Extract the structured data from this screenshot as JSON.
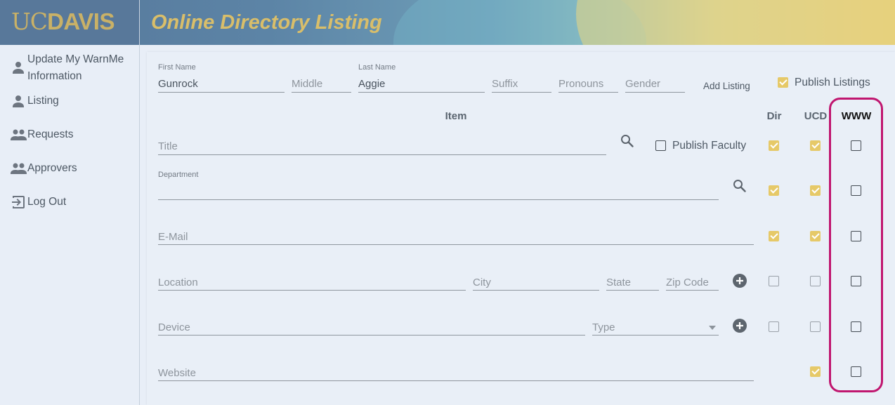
{
  "header": {
    "logo_uc": "UC",
    "logo_davis": "DAVIS",
    "title": "Online Directory Listing"
  },
  "sidebar": {
    "items": [
      {
        "label_line1": "Update My WarnMe",
        "label_line2": "Information",
        "icon": "person-icon"
      },
      {
        "label": "Listing",
        "icon": "person-icon"
      },
      {
        "label": "Requests",
        "icon": "people-icon"
      },
      {
        "label": "Approvers",
        "icon": "people-icon"
      },
      {
        "label": "Log Out",
        "icon": "logout-icon"
      }
    ]
  },
  "name_row": {
    "first_name": {
      "label": "First Name",
      "value": "Gunrock"
    },
    "middle": {
      "placeholder": "Middle"
    },
    "last_name": {
      "label": "Last Name",
      "value": "Aggie"
    },
    "suffix": {
      "placeholder": "Suffix"
    },
    "pronouns": {
      "placeholder": "Pronouns"
    },
    "gender": {
      "placeholder": "Gender"
    },
    "add_listing_label": "Add Listing",
    "publish_listings": {
      "label": "Publish Listings",
      "checked": true
    }
  },
  "columns": {
    "item": "Item",
    "dir": "Dir",
    "ucd": "UCD",
    "www": "WWW"
  },
  "rows": {
    "title": {
      "placeholder": "Title",
      "publish_faculty_label": "Publish Faculty",
      "publish_faculty_checked": false,
      "dir": true,
      "ucd": true,
      "www": false
    },
    "department": {
      "label": "Department",
      "value": "",
      "dir": true,
      "ucd": true,
      "www": false
    },
    "email": {
      "placeholder": "E-Mail",
      "dir": true,
      "ucd": true,
      "www": false
    },
    "location": {
      "placeholder": "Location",
      "city_placeholder": "City",
      "state_placeholder": "State",
      "zip_placeholder": "Zip Code",
      "dir": false,
      "ucd": false,
      "www": false
    },
    "device": {
      "placeholder": "Device",
      "type_placeholder": "Type",
      "dir": false,
      "ucd": false,
      "www": false
    },
    "website": {
      "placeholder": "Website",
      "ucd": true,
      "www": false
    }
  },
  "colors": {
    "accent_gold": "#e6c968",
    "highlight": "#c0166f",
    "header_blue": "#58789a"
  }
}
